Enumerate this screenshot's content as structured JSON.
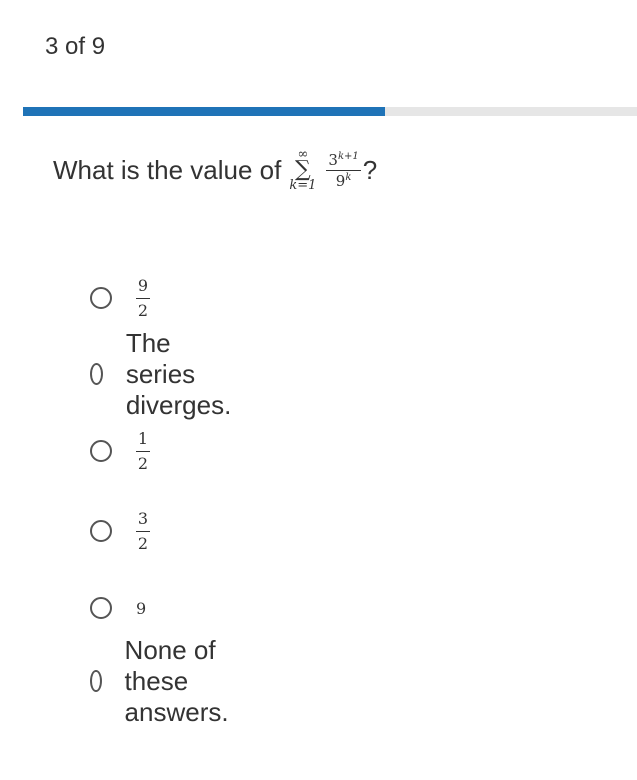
{
  "progress": {
    "label": "3 of 9",
    "current": 3,
    "total": 9,
    "fraction": 0.59,
    "fill_color": "#1f73b7",
    "track_color": "#e6e6e6"
  },
  "question": {
    "prefix": "What is the value of",
    "sum_upper": "∞",
    "sum_symbol": "∑",
    "sum_lower": "k=1",
    "numerator_base": "3",
    "numerator_exp": "k+1",
    "denominator_base": "9",
    "denominator_exp": "k",
    "suffix": "?"
  },
  "options": [
    {
      "type": "fraction",
      "numerator": "9",
      "denominator": "2"
    },
    {
      "type": "text",
      "label": "The series diverges."
    },
    {
      "type": "fraction",
      "numerator": "1",
      "denominator": "2"
    },
    {
      "type": "fraction",
      "numerator": "3",
      "denominator": "2"
    },
    {
      "type": "math",
      "label": "9"
    },
    {
      "type": "text",
      "label": "None of these answers."
    }
  ]
}
